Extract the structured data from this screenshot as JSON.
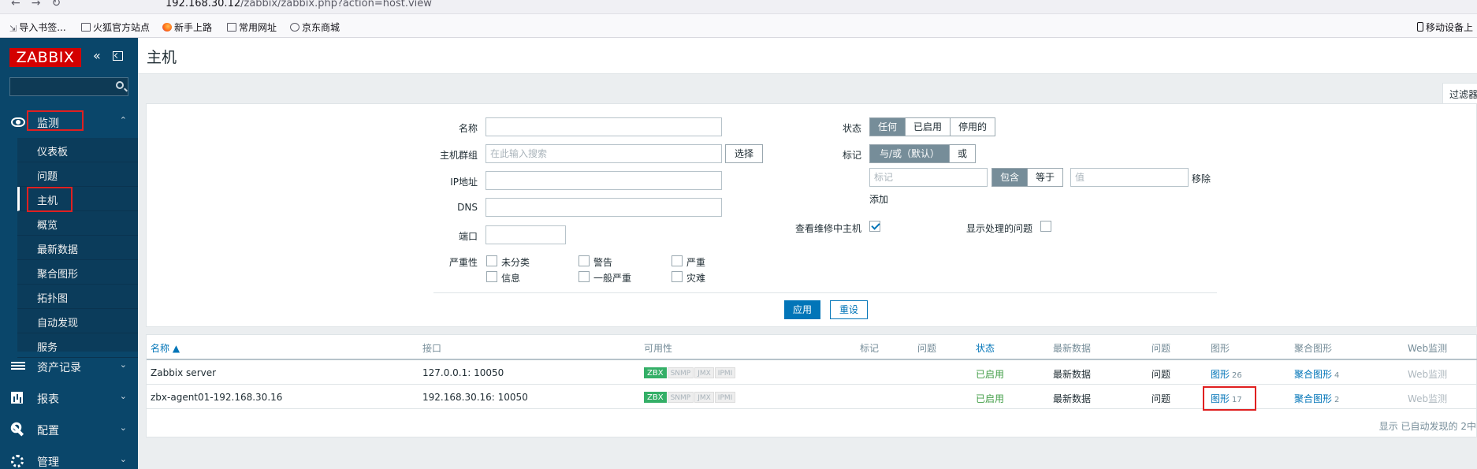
{
  "browser": {
    "address_gray": "192.168.30.12",
    "address_path": "/zabbix/zabbix.php?action=host.view",
    "bookmarks": [
      "导入书签...",
      "火狐官方站点",
      "新手上路",
      "常用网址",
      "京东商城"
    ],
    "mobile_bookmarks": "移动设备上"
  },
  "sidebar": {
    "logo": "ZABBIX",
    "sections": {
      "monitoring": "监测",
      "assets": "资产记录",
      "reports": "报表",
      "config": "配置",
      "admin": "管理"
    },
    "monitoring_items": [
      "仪表板",
      "问题",
      "主机",
      "概览",
      "最新数据",
      "聚合图形",
      "拓扑图",
      "自动发现",
      "服务"
    ]
  },
  "page": {
    "title": "主机",
    "filter_tab": "过滤器"
  },
  "filter": {
    "name_label": "名称",
    "hostgroup_label": "主机群组",
    "hostgroup_placeholder": "在此输入搜索",
    "select_button": "选择",
    "ip_label": "IP地址",
    "dns_label": "DNS",
    "port_label": "端口",
    "severity_label": "严重性",
    "severities": [
      "未分类",
      "警告",
      "严重",
      "信息",
      "一般严重",
      "灾难"
    ],
    "status_label": "状态",
    "status_options": [
      "任何",
      "已启用",
      "停用的"
    ],
    "status_selected": "任何",
    "tags_label": "标记",
    "tag_logic": [
      "与/或（默认）",
      "或"
    ],
    "tag_placeholder": "标记",
    "tag_operators": [
      "包含",
      "等于"
    ],
    "value_placeholder": "值",
    "remove_link": "移除",
    "add_link": "添加",
    "maintenance_label": "查看维修中主机",
    "maintenance_checked": true,
    "suppressed_label": "显示处理的问题",
    "suppressed_checked": false,
    "apply_button": "应用",
    "reset_button": "重设"
  },
  "table": {
    "headers": [
      "名称 ▲",
      "接口",
      "可用性",
      "标记",
      "问题",
      "状态",
      "最新数据",
      "问题",
      "图形",
      "聚合图形",
      "Web监测"
    ],
    "rows": [
      {
        "name": "Zabbix server",
        "interface": "127.0.0.1: 10050",
        "status": "已启用",
        "latest": "最新数据",
        "problems": "问题",
        "graphs": "图形",
        "graphs_count": "26",
        "screens": "聚合图形",
        "screens_count": "4",
        "web": "Web监测"
      },
      {
        "name": "zbx-agent01-192.168.30.16",
        "interface": "192.168.30.16: 10050",
        "status": "已启用",
        "latest": "最新数据",
        "problems": "问题",
        "graphs": "图形",
        "graphs_count": "17",
        "screens": "聚合图形",
        "screens_count": "2",
        "web": "Web监测"
      }
    ],
    "availability_badges": [
      "ZBX",
      "SNMP",
      "JMX",
      "IPMI"
    ],
    "footer": "显示 已自动发现的 2中"
  },
  "colors": {
    "sidebar": "#0a466a",
    "logo": "#d40000",
    "link": "#0275b8",
    "enabled": "#429e47",
    "zbx_badge": "#34af67",
    "annotation": "#e02020"
  }
}
